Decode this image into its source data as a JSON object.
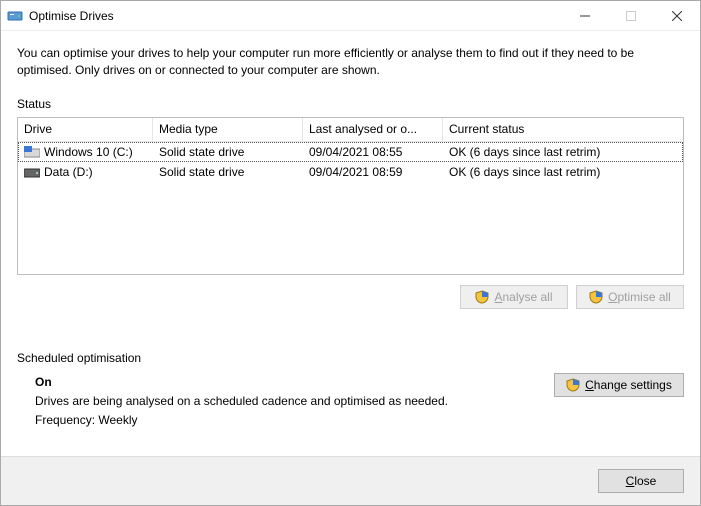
{
  "window": {
    "title": "Optimise Drives"
  },
  "description": "You can optimise your drives to help your computer run more efficiently or analyse them to find out if they need to be optimised. Only drives on or connected to your computer are shown.",
  "status_label": "Status",
  "table": {
    "headers": {
      "drive": "Drive",
      "media": "Media type",
      "last": "Last analysed or o...",
      "status": "Current status"
    },
    "rows": [
      {
        "drive": "Windows 10 (C:)",
        "media": "Solid state drive",
        "last": "09/04/2021 08:55",
        "status": "OK (6 days since last retrim)"
      },
      {
        "drive": "Data (D:)",
        "media": "Solid state drive",
        "last": "09/04/2021 08:59",
        "status": "OK (6 days since last retrim)"
      }
    ]
  },
  "buttons": {
    "analyse_first": "A",
    "analyse_rest": "nalyse all",
    "optimise_first": "O",
    "optimise_rest": "ptimise all",
    "change_first": "C",
    "change_rest": "hange settings",
    "close_first": "C",
    "close_rest": "lose"
  },
  "schedule": {
    "label": "Scheduled optimisation",
    "state": "On",
    "desc": "Drives are being analysed on a scheduled cadence and optimised as needed.",
    "freq": "Frequency: Weekly"
  }
}
